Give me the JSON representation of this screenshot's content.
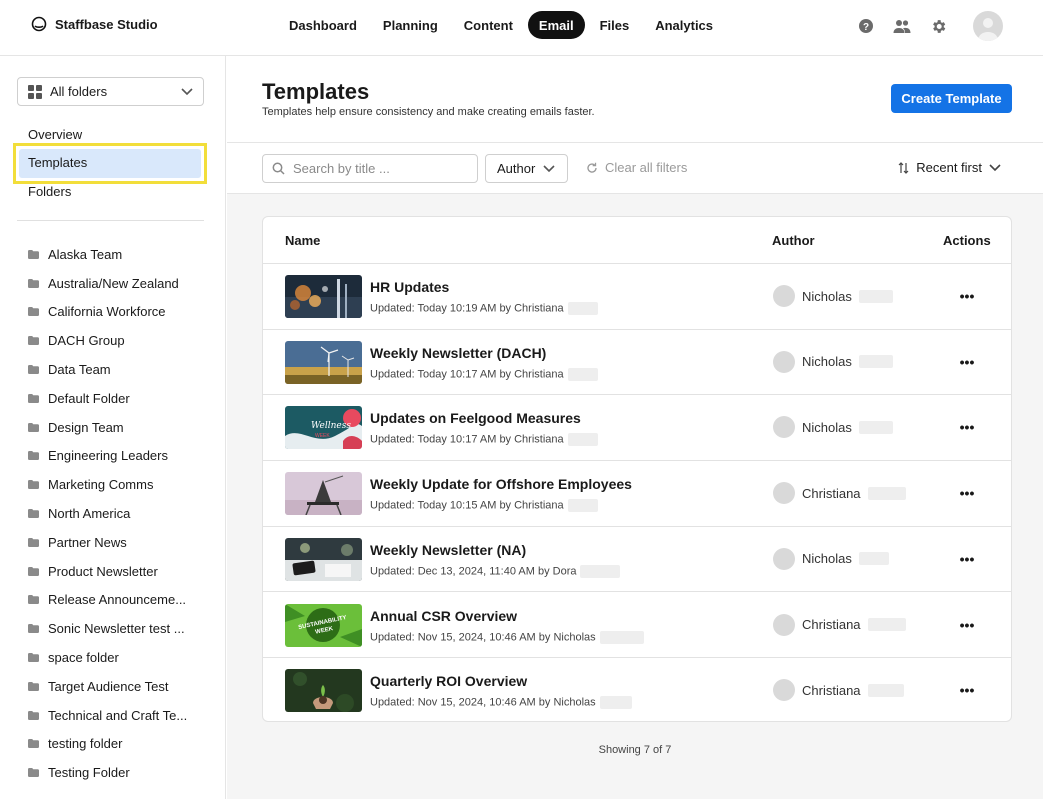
{
  "app": {
    "name": "Staffbase Studio"
  },
  "nav": {
    "items": [
      {
        "label": "Dashboard",
        "active": false
      },
      {
        "label": "Planning",
        "active": false
      },
      {
        "label": "Content",
        "active": false
      },
      {
        "label": "Email",
        "active": true
      },
      {
        "label": "Files",
        "active": false
      },
      {
        "label": "Analytics",
        "active": false
      }
    ]
  },
  "sidebar": {
    "folder_select": "All folders",
    "links": [
      {
        "label": "Overview"
      },
      {
        "label": "Templates",
        "selected": true
      },
      {
        "label": "Folders"
      }
    ],
    "folders": [
      "Alaska Team",
      "Australia/New Zealand",
      "California Workforce",
      "DACH Group",
      "Data Team",
      "Default Folder",
      "Design Team",
      "Engineering Leaders",
      "Marketing Comms",
      "North America",
      "Partner News",
      "Product Newsletter",
      "Release Announceme...",
      "Sonic Newsletter test ...",
      "space folder",
      "Target Audience Test",
      "Technical and Craft Te...",
      "testing folder",
      "Testing Folder"
    ]
  },
  "header": {
    "title": "Templates",
    "subtitle": "Templates help ensure consistency and make creating emails faster.",
    "create_button": "Create Template"
  },
  "filters": {
    "search_placeholder": "Search by title ...",
    "author_label": "Author",
    "clear_label": "Clear all filters",
    "sort_label": "Recent first"
  },
  "table": {
    "columns": {
      "name": "Name",
      "author": "Author",
      "actions": "Actions"
    },
    "rows": [
      {
        "title": "HR Updates",
        "meta": "Updated: Today 10:19 AM by Christiana",
        "author": "Nicholas",
        "thumb": "city-night"
      },
      {
        "title": "Weekly Newsletter (DACH)",
        "meta": "Updated: Today 10:17 AM by Christiana",
        "author": "Nicholas",
        "thumb": "wind-turbines"
      },
      {
        "title": "Updates on Feelgood Measures",
        "meta": "Updated: Today 10:17 AM by Christiana",
        "author": "Nicholas",
        "thumb": "wellness-week"
      },
      {
        "title": "Weekly Update for Offshore Employees",
        "meta": "Updated: Today 10:15 AM by Christiana",
        "author": "Christiana",
        "thumb": "offshore-rig"
      },
      {
        "title": "Weekly Newsletter (NA)",
        "meta": "Updated: Dec 13, 2024, 11:40 AM by Dora",
        "author": "Nicholas",
        "thumb": "desk-phone"
      },
      {
        "title": "Annual CSR Overview",
        "meta": "Updated: Nov 15, 2024, 10:46 AM by Nicholas",
        "author": "Christiana",
        "thumb": "sustainability-week",
        "thumb_text": "SUSTAINABILITY WEEK"
      },
      {
        "title": "Quarterly ROI Overview",
        "meta": "Updated: Nov 15, 2024, 10:46 AM by Nicholas",
        "author": "Christiana",
        "thumb": "plant-hands"
      }
    ]
  },
  "footer": {
    "showing": "Showing 7 of 7"
  },
  "colors": {
    "primary": "#1473e6",
    "selection": "#d9e8fb",
    "highlight": "#f2de3a",
    "active_nav": "#111111"
  }
}
